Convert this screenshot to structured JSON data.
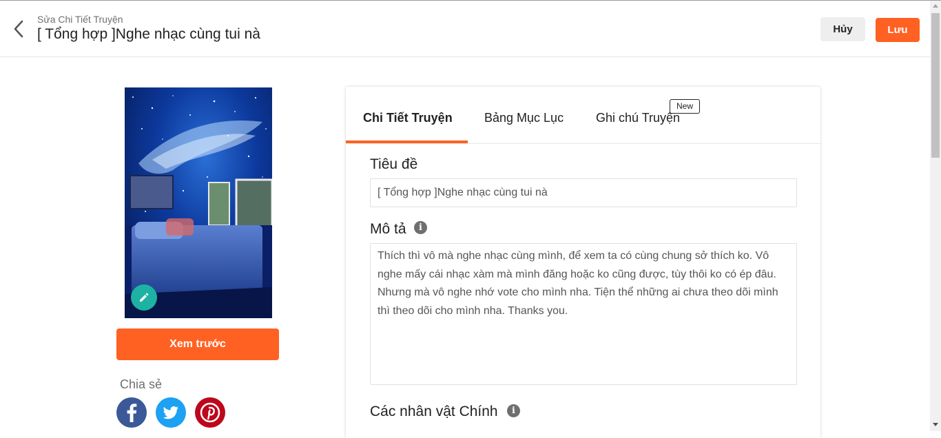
{
  "header": {
    "back_icon": "chevron-left-icon",
    "subtitle": "Sửa Chi Tiết Truyện",
    "title": "[ Tổng hợp ]Nghe nhạc cùng tui nà",
    "cancel_label": "Hủy",
    "save_label": "Lưu"
  },
  "sidebar": {
    "edit_icon": "pencil-icon",
    "preview_label": "Xem trước",
    "share_label": "Chia sẻ",
    "social": [
      "facebook-icon",
      "twitter-icon",
      "pinterest-icon"
    ]
  },
  "tabs": {
    "items": [
      {
        "label": "Chi Tiết Truyện",
        "active": true
      },
      {
        "label": "Bảng Mục Lục",
        "active": false
      },
      {
        "label": "Ghi chú Truyện",
        "active": false
      }
    ],
    "new_badge": "New"
  },
  "form": {
    "title_label": "Tiêu đề",
    "title_value": "[ Tổng hợp ]Nghe nhạc cùng tui nà",
    "description_label": "Mô tả",
    "description_value": "Thích thì vô mà nghe nhạc cùng mình, để xem ta có cùng chung sở thích ko. Vô nghe mấy cái nhạc xàm mà mình đăng hoặc ko cũng được, tùy thôi ko có ép đâu. Nhưng mà vô nghe nhớ vote cho mình nha. Tiện thể những ai chưa theo dõi mình thì theo dõi cho mình nha. Thanks you.",
    "main_characters_label": "Các nhân vật Chính",
    "info_icon": "info-icon"
  },
  "colors": {
    "accent": "#ff6122",
    "edit_button": "#1db2a3",
    "facebook": "#3b5998",
    "twitter": "#1da1f2",
    "pinterest": "#bd081c"
  }
}
